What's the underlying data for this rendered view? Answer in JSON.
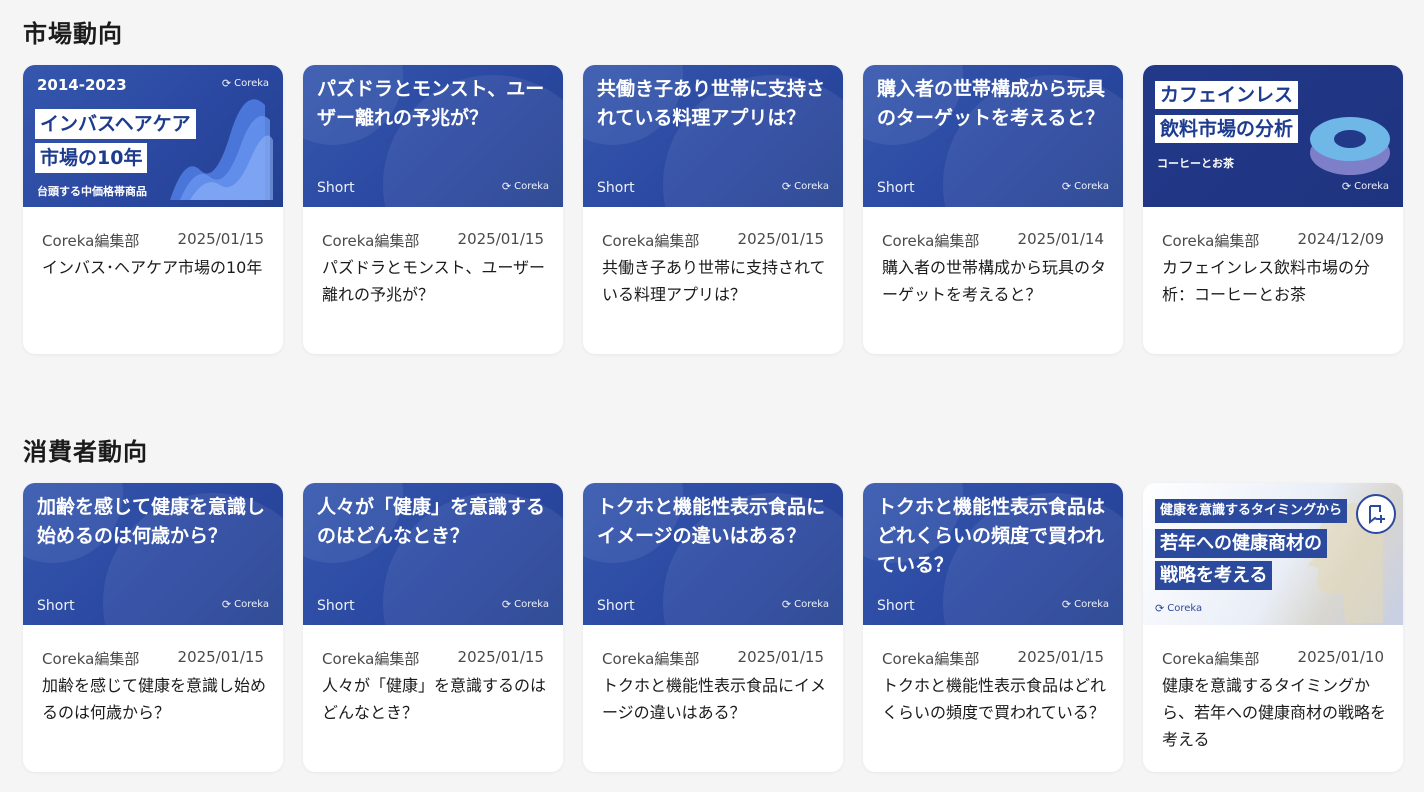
{
  "sections": [
    {
      "title": "市場動向",
      "cards": [
        {
          "thumb_type": "cover",
          "cover": {
            "year": "2014-2023",
            "box1": "インバスヘアケア",
            "box2": "市場の10年",
            "sub": "台頭する中価格帯商品",
            "logo": "Coreka"
          },
          "author": "Coreka編集部",
          "date": "2025/01/15",
          "title": "インバス･ヘアケア市場の10年"
        },
        {
          "thumb_type": "short",
          "thumb_title": "パズドラとモンスト、ユーザー離れの予兆が？",
          "short_label": "Short",
          "logo": "Coreka",
          "author": "Coreka編集部",
          "date": "2025/01/15",
          "title": "パズドラとモンスト、ユーザー離れの予兆が？"
        },
        {
          "thumb_type": "short",
          "thumb_title": "共働き子あり世帯に支持されている料理アプリは？",
          "short_label": "Short",
          "logo": "Coreka",
          "author": "Coreka編集部",
          "date": "2025/01/15",
          "title": "共働き子あり世帯に支持されている料理アプリは？"
        },
        {
          "thumb_type": "short",
          "thumb_title": "購入者の世帯構成から玩具のターゲットを考えると？",
          "short_label": "Short",
          "logo": "Coreka",
          "author": "Coreka編集部",
          "date": "2025/01/14",
          "title": "購入者の世帯構成から玩具のターゲットを考えると？"
        },
        {
          "thumb_type": "cover2",
          "cover": {
            "box1": "カフェインレス",
            "box2": "飲料市場の分析",
            "sub": "コーヒーとお茶",
            "logo": "Coreka"
          },
          "author": "Coreka編集部",
          "date": "2024/12/09",
          "title": "カフェインレス飲料市場の分析：コーヒーとお茶"
        }
      ]
    },
    {
      "title": "消費者動向",
      "cards": [
        {
          "thumb_type": "short",
          "thumb_title": "加齢を感じて健康を意識し始めるのは何歳から？",
          "short_label": "Short",
          "logo": "Coreka",
          "author": "Coreka編集部",
          "date": "2025/01/15",
          "title": "加齢を感じて健康を意識し始めるのは何歳から？"
        },
        {
          "thumb_type": "short",
          "thumb_title": "人々が「健康」を意識するのはどんなとき？",
          "short_label": "Short",
          "logo": "Coreka",
          "author": "Coreka編集部",
          "date": "2025/01/15",
          "title": "人々が「健康」を意識するのはどんなとき？"
        },
        {
          "thumb_type": "short",
          "thumb_title": "トクホと機能性表示食品にイメージの違いはある？",
          "short_label": "Short",
          "logo": "Coreka",
          "author": "Coreka編集部",
          "date": "2025/01/15",
          "title": "トクホと機能性表示食品にイメージの違いはある？"
        },
        {
          "thumb_type": "short",
          "thumb_title": "トクホと機能性表示食品はどれくらいの頻度で買われている？",
          "short_label": "Short",
          "logo": "Coreka",
          "author": "Coreka編集部",
          "date": "2025/01/15",
          "title": "トクホと機能性表示食品はどれくらいの頻度で買われている？"
        },
        {
          "thumb_type": "cover3",
          "cover": {
            "box1": "健康を意識するタイミングから",
            "box2": "若年への健康商材の",
            "box3": "戦略を考える",
            "logo": "Coreka"
          },
          "author": "Coreka編集部",
          "date": "2025/01/10",
          "title": "健康を意識するタイミングから、若年への健康商材の戦略を考える"
        }
      ]
    }
  ],
  "colors": {
    "thumb_blue": "#2a47a0",
    "accent_dark": "#1d3b8f"
  }
}
